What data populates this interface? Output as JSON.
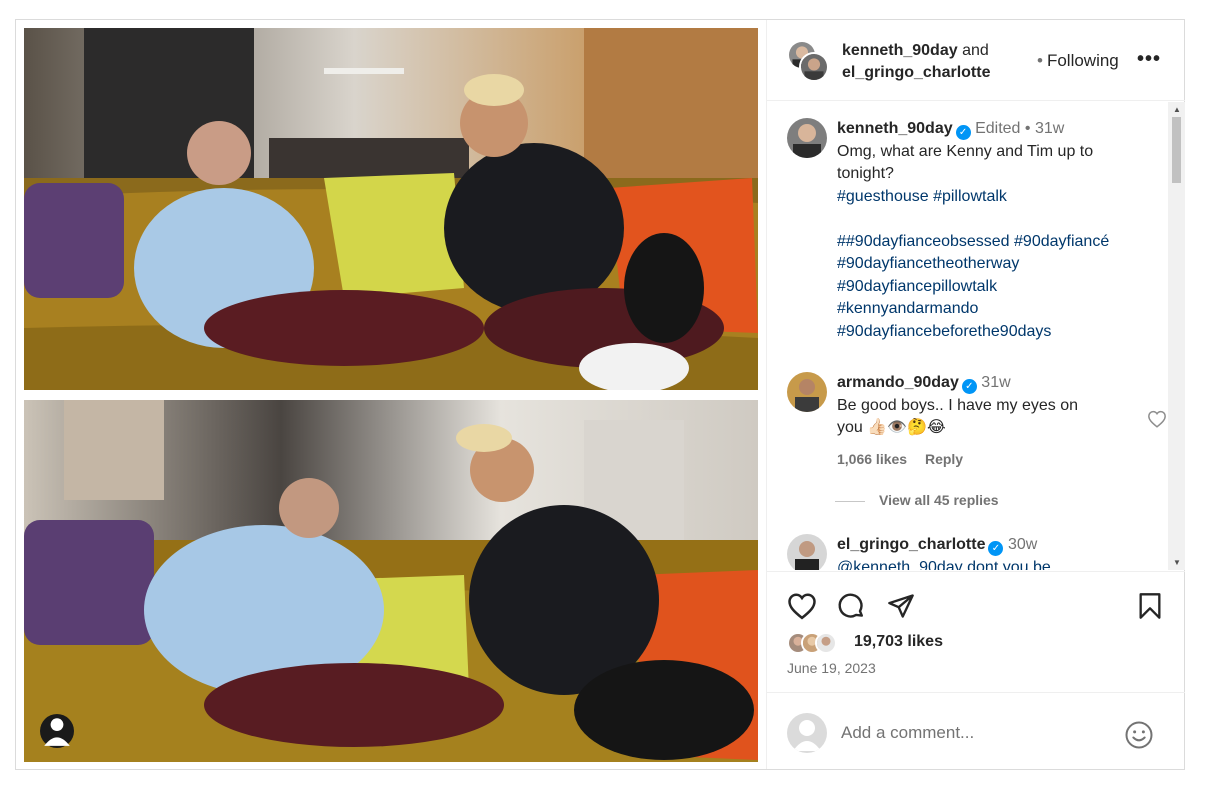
{
  "header": {
    "author1": "kenneth_90day",
    "and_text": "and",
    "author2": "el_gringo_charlotte",
    "follow_dot": "•",
    "follow_label": "Following",
    "more_label": "•••"
  },
  "caption": {
    "username": "kenneth_90day",
    "edited": "Edited",
    "sep": "•",
    "time": "31w",
    "text_line1": "Omg, what are Kenny and Tim up to",
    "text_line2": "tonight?",
    "tags1": "#guesthouse #pillowtalk",
    "tags2": "##90dayfianceobsessed #90dayfiancé",
    "tags3": "#90dayfiancetheotherway",
    "tags4": "#90dayfiancepillowtalk",
    "tags5": "#kennyandarmando",
    "tags6": "#90dayfiancebeforethe90days"
  },
  "comments": [
    {
      "username": "armando_90day",
      "time": "31w",
      "text_line1": "Be good boys.. I have my eyes on",
      "text_line2": "you 👍🏻👁️🤔😂",
      "likes": "1,066 likes",
      "reply": "Reply"
    },
    {
      "username": "el_gringo_charlotte",
      "time": "30w",
      "text_line1": "@kenneth_90day dont you be"
    }
  ],
  "view_replies": "View all 45 replies",
  "actions": {
    "likes": "19,703 likes",
    "date": "June 19, 2023"
  },
  "add_comment": {
    "placeholder": "Add a comment..."
  },
  "colors": {
    "accent": "#0095f6",
    "hashtag": "#00376b",
    "secondary_text": "#737373",
    "border": "#dbdbdb"
  },
  "icons": [
    "heart-icon",
    "comment-icon",
    "share-icon",
    "bookmark-icon",
    "emoji-icon",
    "user-tag-icon",
    "verified-badge-icon"
  ]
}
